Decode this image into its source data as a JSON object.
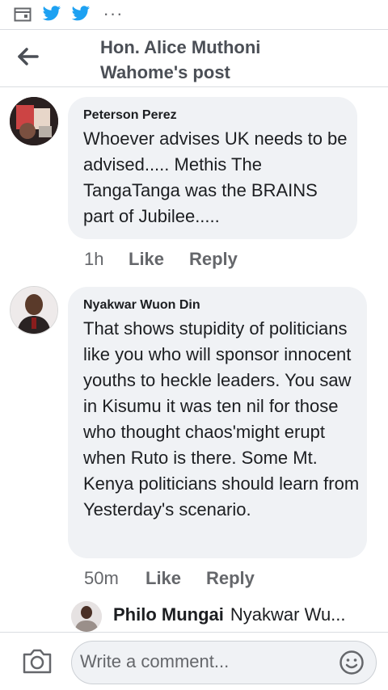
{
  "statusbar": {
    "icons": [
      "calendar-icon",
      "twitter-icon",
      "twitter-icon",
      "more-dots-icon"
    ],
    "more": "···"
  },
  "header": {
    "title": "Hon. Alice Muthoni Wahome's post"
  },
  "comments": [
    {
      "author": "Peterson Perez",
      "text": "Whoever advises UK needs to be advised..... Methis The TangaTanga was the BRAINS part of Jubilee.....",
      "time": "1h",
      "like": "Like",
      "reply": "Reply"
    },
    {
      "author": "Nyakwar Wuon Din",
      "text": "That shows stupidity of politicians like you who will sponsor innocent youths to heckle leaders. You saw in Kisumu it was ten nil for those who thought chaos'might erupt when Ruto is there. Some Mt. Kenya politicians should learn from Yesterday's scenario.",
      "time": "50m",
      "like": "Like",
      "reply": "Reply"
    }
  ],
  "reply": {
    "author": "Philo Mungai",
    "preview": "Nyakwar Wu..."
  },
  "composer": {
    "placeholder": "Write a comment...",
    "icons": [
      "camera-icon",
      "emoji-icon"
    ]
  },
  "colors": {
    "twitter": "#1da1f2",
    "bubble": "#f0f2f5",
    "meta": "#65676b"
  }
}
